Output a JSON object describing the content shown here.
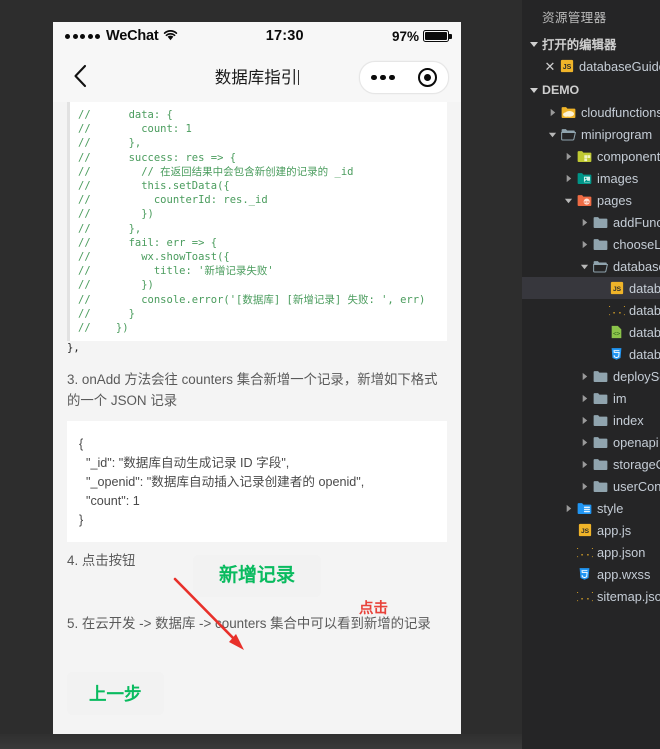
{
  "phone": {
    "status_bar": {
      "carrier": "WeChat",
      "time": "17:30",
      "battery_percent": "97%"
    },
    "nav": {
      "title": "数据库指引",
      "back_icon": "chevron-left-icon",
      "menu_icon": "more-dots-icon",
      "target_icon": "target-circle-icon"
    },
    "code_block": {
      "lines": [
        "//      data: {",
        "//        count: 1",
        "//      },",
        "//      success: res => {",
        "//        // 在返回结果中会包含新创建的记录的 _id",
        "//        this.setData({",
        "//          counterId: res._id",
        "//        })",
        "//      },",
        "//      fail: err => {",
        "//        wx.showToast({",
        "//          title: '新增记录失败'",
        "//        })",
        "//        console.error('[数据库] [新增记录] 失败: ', err)",
        "//      }",
        "//    })"
      ],
      "tail": "  },"
    },
    "step3_text": "3. onAdd 方法会往 counters 集合新增一个记录，新增如下格式的一个 JSON 记录",
    "json_block": {
      "lines": [
        "{",
        "  \"_id\": \"数据库自动生成记录 ID 字段\",",
        "  \"_openid\": \"数据库自动插入记录创建者的 openid\",",
        "  \"count\": 1",
        "}"
      ]
    },
    "annotation": {
      "click_label": "点击",
      "arrow_color": "#e8302a"
    },
    "step4_text": "4. 点击按钮",
    "add_button_label": "新增记录",
    "step5_text": "5. 在云开发 -> 数据库 -> counters 集合中可以看到新增的记录",
    "prev_button_label": "上一步",
    "accent_green": "#09bb5f"
  },
  "explorer": {
    "title": "资源管理器",
    "open_editors": {
      "label": "打开的编辑器",
      "expanded": true,
      "items": [
        {
          "name": "databaseGuide.js",
          "icon": "js-file-icon",
          "close_icon": "close-icon"
        }
      ]
    },
    "project": {
      "label": "DEMO",
      "expanded": true
    },
    "tree": [
      {
        "label": "cloudfunctions",
        "icon": "folder-cloud-icon",
        "indent": 1,
        "expanded": false,
        "arrow": "chevron-right-icon",
        "color": "#f0b429"
      },
      {
        "label": "miniprogram",
        "icon": "folder-open-icon",
        "indent": 1,
        "expanded": true,
        "arrow": "chevron-down-icon",
        "color": "#90a4ae"
      },
      {
        "label": "components",
        "icon": "folder-components-icon",
        "indent": 2,
        "expanded": false,
        "arrow": "chevron-right-icon",
        "color": "#c0ca33"
      },
      {
        "label": "images",
        "icon": "folder-images-icon",
        "indent": 2,
        "expanded": false,
        "arrow": "chevron-right-icon",
        "color": "#009688"
      },
      {
        "label": "pages",
        "icon": "folder-pages-icon",
        "indent": 2,
        "expanded": true,
        "arrow": "chevron-down-icon",
        "color": "#ef6c45"
      },
      {
        "label": "addFunction",
        "icon": "folder-icon",
        "indent": 3,
        "expanded": false,
        "arrow": "chevron-right-icon",
        "color": "#90a4ae"
      },
      {
        "label": "chooseLib",
        "icon": "folder-icon",
        "indent": 3,
        "expanded": false,
        "arrow": "chevron-right-icon",
        "color": "#90a4ae"
      },
      {
        "label": "databaseGuide",
        "icon": "folder-open-icon",
        "indent": 3,
        "expanded": true,
        "arrow": "chevron-down-icon",
        "color": "#90a4ae"
      },
      {
        "label": "databaseGuide.js",
        "icon": "js-file-icon",
        "indent": 4,
        "selected": true,
        "color": "#f0b429"
      },
      {
        "label": "databaseGuide.json",
        "icon": "json-file-icon",
        "indent": 4,
        "selected": false,
        "color": "#f0b429"
      },
      {
        "label": "databaseGuide.wxml",
        "icon": "xml-file-icon",
        "indent": 4,
        "selected": false,
        "color": "#8bc34a"
      },
      {
        "label": "databaseGuide.wxss",
        "icon": "css-file-icon",
        "indent": 4,
        "selected": false,
        "color": "#2196f3"
      },
      {
        "label": "deployService",
        "icon": "folder-icon",
        "indent": 3,
        "expanded": false,
        "arrow": "chevron-right-icon",
        "color": "#90a4ae"
      },
      {
        "label": "im",
        "icon": "folder-icon",
        "indent": 3,
        "expanded": false,
        "arrow": "chevron-right-icon",
        "color": "#90a4ae"
      },
      {
        "label": "index",
        "icon": "folder-icon",
        "indent": 3,
        "expanded": false,
        "arrow": "chevron-right-icon",
        "color": "#90a4ae"
      },
      {
        "label": "openapi",
        "icon": "folder-icon",
        "indent": 3,
        "expanded": false,
        "arrow": "chevron-right-icon",
        "color": "#90a4ae"
      },
      {
        "label": "storageConsole",
        "icon": "folder-icon",
        "indent": 3,
        "expanded": false,
        "arrow": "chevron-right-icon",
        "color": "#90a4ae"
      },
      {
        "label": "userConsole",
        "icon": "folder-icon",
        "indent": 3,
        "expanded": false,
        "arrow": "chevron-right-icon",
        "color": "#90a4ae"
      },
      {
        "label": "style",
        "icon": "folder-style-icon",
        "indent": 2,
        "expanded": false,
        "arrow": "chevron-right-icon",
        "color": "#2196f3"
      },
      {
        "label": "app.js",
        "icon": "js-file-icon",
        "indent": 2,
        "color": "#f0b429"
      },
      {
        "label": "app.json",
        "icon": "json-file-icon",
        "indent": 2,
        "color": "#f0b429"
      },
      {
        "label": "app.wxss",
        "icon": "css-file-icon",
        "indent": 2,
        "color": "#2196f3"
      },
      {
        "label": "sitemap.json",
        "icon": "json-file-icon",
        "indent": 2,
        "color": "#f0b429"
      }
    ]
  }
}
